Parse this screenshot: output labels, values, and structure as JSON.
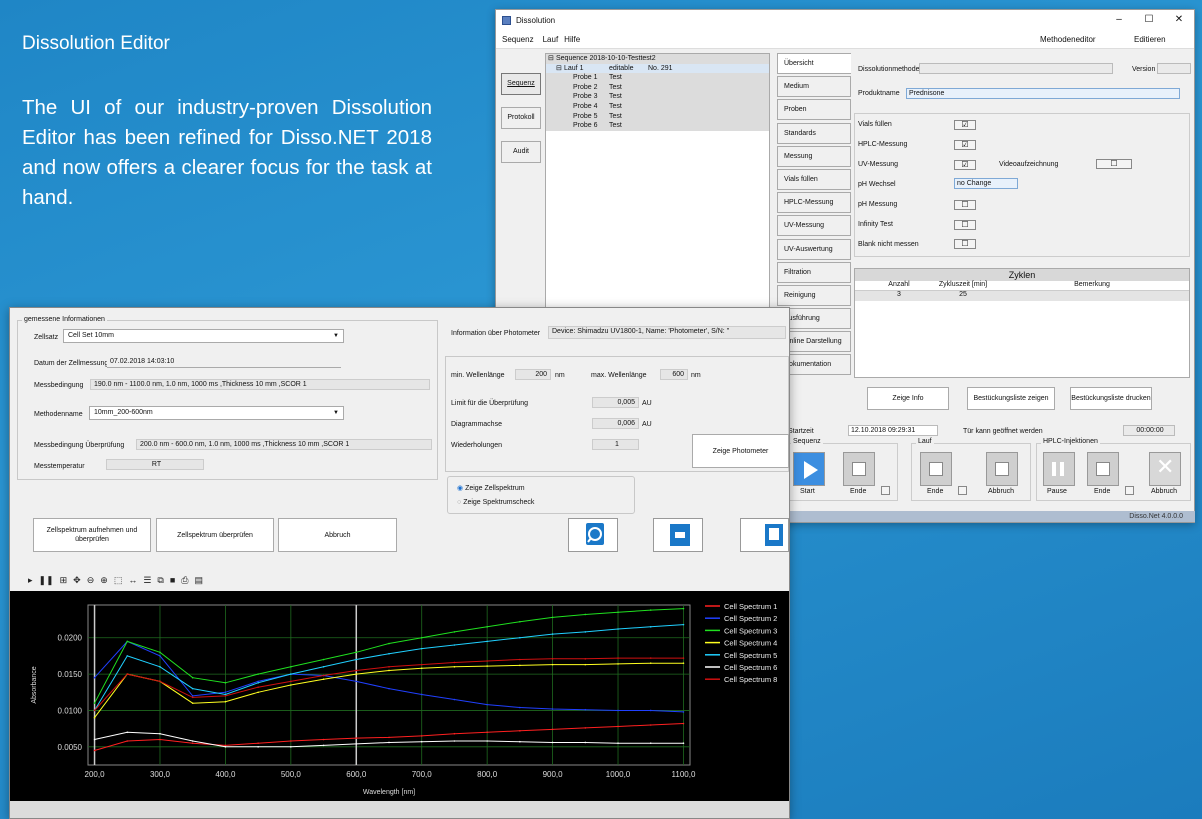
{
  "promo": {
    "title": "Dissolution Editor",
    "text": "The UI of our industry-proven Dissolution Editor has been refined for Disso.NET 2018 and now offers a clearer focus for the task at hand."
  },
  "bg_window": {
    "title": "Dissolution",
    "menu_left": [
      "Sequenz",
      "Lauf",
      "Hilfe"
    ],
    "menu_right": [
      "Methodeneditor",
      "Editieren"
    ],
    "left_tabs": [
      "Sequenz",
      "Protokoll",
      "Audit"
    ],
    "tree": {
      "root": "Sequence 2018-10-10-Testtest2",
      "run": {
        "name": "Lauf 1",
        "status": "editable",
        "no": "No. 291"
      },
      "samples": [
        {
          "name": "Probe 1",
          "val": "Test"
        },
        {
          "name": "Probe 2",
          "val": "Test"
        },
        {
          "name": "Probe 3",
          "val": "Test"
        },
        {
          "name": "Probe 4",
          "val": "Test"
        },
        {
          "name": "Probe 5",
          "val": "Test"
        },
        {
          "name": "Probe 6",
          "val": "Test"
        }
      ]
    },
    "nav_tabs": [
      "Übersicht",
      "Medium",
      "Proben",
      "Standards",
      "Messung",
      "Vials füllen",
      "HPLC-Messung",
      "UV-Messung",
      "UV-Auswertung",
      "Filtration",
      "Reinigung",
      "Ausführung",
      "Online Darstellung",
      "Dokumentation"
    ],
    "method_label": "Dissolutionmethode",
    "method_value": "",
    "version_label": "Version",
    "product_label": "Produktname",
    "product_value": "Prednisone",
    "options": [
      {
        "label": "Vials füllen",
        "checked": "☑"
      },
      {
        "label": "HPLC-Messung",
        "checked": "☑"
      },
      {
        "label": "UV-Messung",
        "checked": "☑"
      },
      {
        "label": "pH Wechsel",
        "checked": ""
      },
      {
        "label": "pH Messung",
        "checked": "☐"
      },
      {
        "label": "Infinity Test",
        "checked": "☐"
      },
      {
        "label": "Blank nicht messen",
        "checked": "☐"
      }
    ],
    "video_label": "Videoaufzeichnung",
    "video_checked": "☐",
    "ph_value": "no Change",
    "cycles": {
      "title": "Zyklen",
      "columns": [
        "Anzahl",
        "Zykluszeit [min]",
        "Bemerkung"
      ],
      "rows": [
        [
          "3",
          "25",
          ""
        ]
      ]
    },
    "buttons": [
      "Zeige Info",
      "Bestückungsliste zeigen",
      "Bestückungsliste drucken"
    ],
    "start_label": "Startzeit",
    "start_value": "12.10.2018 09:29:31",
    "door_text": "Tür kann geöffnet werden",
    "timer": "00:00:00",
    "groups": {
      "sequenz": {
        "title": "Sequenz",
        "start": "Start",
        "end": "Ende"
      },
      "lauf": {
        "title": "Lauf",
        "end": "Ende",
        "abort": "Abbruch"
      },
      "hplc": {
        "title": "HPLC-Injektionen",
        "pause": "Pause",
        "end": "Ende",
        "abort": "Abbruch"
      }
    },
    "status": "Disso.Net 4.0.0.0"
  },
  "fg_window": {
    "info_group_title": "gemessene Informationen",
    "cellset_label": "Zellsatz",
    "cellset_value": "Cell Set 10mm",
    "date_label": "Datum der Zellmessung",
    "date_value": "07.02.2018 14:03:10",
    "cond_label": "Messbedingung",
    "cond_value": "190.0 nm - 1100.0 nm, 1.0 nm, 1000 ms ,Thickness 10 mm ,SCOR 1",
    "methodname_label": "Methodenname",
    "methodname_value": "10mm_200-600nm",
    "cond_check_label": "Messbedingung Überprüfung",
    "cond_check_value": "200.0 nm - 600.0 nm, 1.0 nm, 1000 ms ,Thickness 10 mm ,SCOR 1",
    "temp_label": "Messtemperatur",
    "temp_value": "RT",
    "photometer_label": "Information über Photometer",
    "photometer_value": "Device: Shimadzu UV1800-1, Name: 'Photometer', S/N: ''",
    "min_wl_label": "min. Wellenlänge",
    "min_wl_value": "200",
    "max_wl_label": "max. Wellenlänge",
    "max_wl_value": "600",
    "unit_nm": "nm",
    "limit_label": "Limit für die Überprüfung",
    "limit_value": "0,005",
    "diag_label": "Diagrammachse",
    "diag_value": "0,006",
    "unit_au": "AU",
    "rep_label": "Wiederholungen",
    "rep_value": "1",
    "show_photometer": "Zeige Photometer",
    "radio1": "Zeige Zellspektrum",
    "radio2": "Zeige Spektrumscheck",
    "btn_record": "Zellspektrum aufnehmen und überprüfen",
    "btn_check": "Zellspektrum überprüfen",
    "btn_abort": "Abbruch"
  },
  "chart_data": {
    "type": "line",
    "xlabel": "Wavelength [nm]",
    "ylabel": "Absorbance",
    "xlim": [
      190,
      1110
    ],
    "ylim": [
      0.0025,
      0.0245
    ],
    "xticks": [
      "200,0",
      "300,0",
      "400,0",
      "500,0",
      "600,0",
      "700,0",
      "800,0",
      "900,0",
      "1000,0",
      "1100,0"
    ],
    "yticks": [
      "0.0050",
      "0.0100",
      "0.0150",
      "0.0200"
    ],
    "grid": true,
    "legend": "top-right",
    "x": [
      200,
      250,
      300,
      350,
      400,
      450,
      500,
      550,
      600,
      650,
      700,
      750,
      800,
      850,
      900,
      950,
      1000,
      1050,
      1100
    ],
    "series": [
      {
        "name": "Cell Spectrum 1",
        "color": "#ff2020",
        "values": [
          0.0045,
          0.0058,
          0.006,
          0.0055,
          0.0052,
          0.0055,
          0.0058,
          0.006,
          0.0062,
          0.0063,
          0.0065,
          0.0068,
          0.007,
          0.0072,
          0.0074,
          0.0076,
          0.0078,
          0.008,
          0.0082
        ]
      },
      {
        "name": "Cell Spectrum 2",
        "color": "#2040ff",
        "values": [
          0.0145,
          0.0195,
          0.0175,
          0.012,
          0.0125,
          0.014,
          0.015,
          0.0148,
          0.014,
          0.013,
          0.0122,
          0.0115,
          0.0108,
          0.0104,
          0.0102,
          0.0101,
          0.01,
          0.01,
          0.0098
        ]
      },
      {
        "name": "Cell Spectrum 3",
        "color": "#20e020",
        "values": [
          0.011,
          0.0195,
          0.018,
          0.0145,
          0.0138,
          0.015,
          0.016,
          0.017,
          0.018,
          0.0192,
          0.02,
          0.0208,
          0.0215,
          0.0222,
          0.0228,
          0.0232,
          0.0235,
          0.0238,
          0.024
        ]
      },
      {
        "name": "Cell Spectrum 4",
        "color": "#ffff20",
        "values": [
          0.009,
          0.015,
          0.014,
          0.011,
          0.0112,
          0.0125,
          0.0135,
          0.0143,
          0.015,
          0.0155,
          0.0158,
          0.016,
          0.0161,
          0.0162,
          0.0163,
          0.0163,
          0.0164,
          0.0165,
          0.0165
        ]
      },
      {
        "name": "Cell Spectrum 5",
        "color": "#20d0ff",
        "values": [
          0.01,
          0.0175,
          0.016,
          0.013,
          0.0122,
          0.0138,
          0.015,
          0.016,
          0.017,
          0.0178,
          0.0185,
          0.019,
          0.0195,
          0.02,
          0.0205,
          0.0208,
          0.0212,
          0.0215,
          0.0218
        ]
      },
      {
        "name": "Cell Spectrum 6",
        "color": "#ffffff",
        "values": [
          0.006,
          0.007,
          0.0068,
          0.0058,
          0.005,
          0.005,
          0.005,
          0.0052,
          0.0054,
          0.0056,
          0.0057,
          0.0058,
          0.0058,
          0.0057,
          0.0056,
          0.0056,
          0.0055,
          0.0055,
          0.0055
        ]
      },
      {
        "name": "Cell Spectrum 8",
        "color": "#d01010",
        "values": [
          0.01,
          0.015,
          0.014,
          0.0118,
          0.012,
          0.0132,
          0.014,
          0.0148,
          0.0155,
          0.016,
          0.0163,
          0.0166,
          0.0168,
          0.017,
          0.0171,
          0.0171,
          0.0172,
          0.0172,
          0.0172
        ]
      }
    ]
  }
}
